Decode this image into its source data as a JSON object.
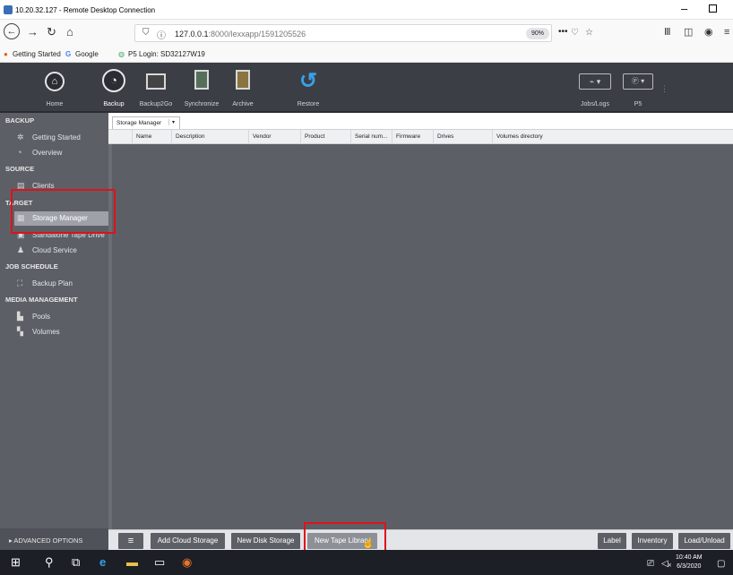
{
  "rdp_window": {
    "title": "10.20.32.127 - Remote Desktop Connection",
    "minimize": "–"
  },
  "browser": {
    "url_host": "127.0.0.1",
    "url_rest": ":8000/lexxapp/1591205526",
    "zoom": "90%",
    "more": "•••",
    "bookmarks": [
      "Getting Started",
      "Google",
      "P5 Login: SD32127W19"
    ]
  },
  "header": {
    "left_buttons": [
      "Home",
      "Backup",
      "Backup2Go",
      "Synchronize",
      "Archive",
      "Restore"
    ],
    "right_buttons": [
      "Jobs/Logs",
      "P5"
    ]
  },
  "sidebar": {
    "sections": [
      {
        "title": "BACKUP",
        "items": [
          "Getting Started",
          "Overview"
        ]
      },
      {
        "title": "SOURCE",
        "items": [
          "Clients"
        ]
      },
      {
        "title": "TARGET",
        "items": [
          "Storage Manager",
          "Standalone Tape Drive",
          "Cloud Service"
        ]
      },
      {
        "title": "JOB SCHEDULE",
        "items": [
          "Backup Plan"
        ]
      },
      {
        "title": "MEDIA MANAGEMENT",
        "items": [
          "Pools",
          "Volumes"
        ]
      }
    ],
    "active_item": "Storage Manager",
    "advanced": "▸ ADVANCED OPTIONS"
  },
  "main": {
    "tab": "Storage Manager",
    "tab_dropdown": "▾",
    "columns": [
      "Name",
      "Description",
      "Vendor",
      "Product",
      "Serial num...",
      "Firmware",
      "Drives",
      "Volumes directory"
    ]
  },
  "bottom_toolbar": {
    "menu": "≡",
    "buttons": [
      "Add Cloud Storage",
      "New Disk Storage",
      "New Tape Library"
    ],
    "right_buttons": [
      "Label",
      "Inventory",
      "Load/Unload"
    ]
  },
  "taskbar": {
    "time": "10:40 AM",
    "date": "6/3/2020"
  },
  "colors": {
    "header_bg": "#3b3e45",
    "sidebar_bg": "#5c6066",
    "highlight_red": "#e0111a"
  }
}
